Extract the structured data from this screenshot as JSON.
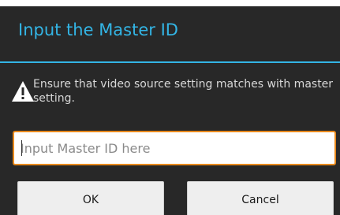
{
  "dialog": {
    "title": "Input the Master ID",
    "message": "Ensure that video source setting matches with master setting.",
    "warning_icon": "warning-triangle-icon",
    "input": {
      "value": "",
      "placeholder": "Input Master ID here"
    },
    "buttons": {
      "ok_label": "OK",
      "cancel_label": "Cancel"
    }
  },
  "colors": {
    "title": "#33b5e5",
    "background": "#282828",
    "input_focus_border": "#e8891c",
    "button_background": "#eeeeee"
  }
}
